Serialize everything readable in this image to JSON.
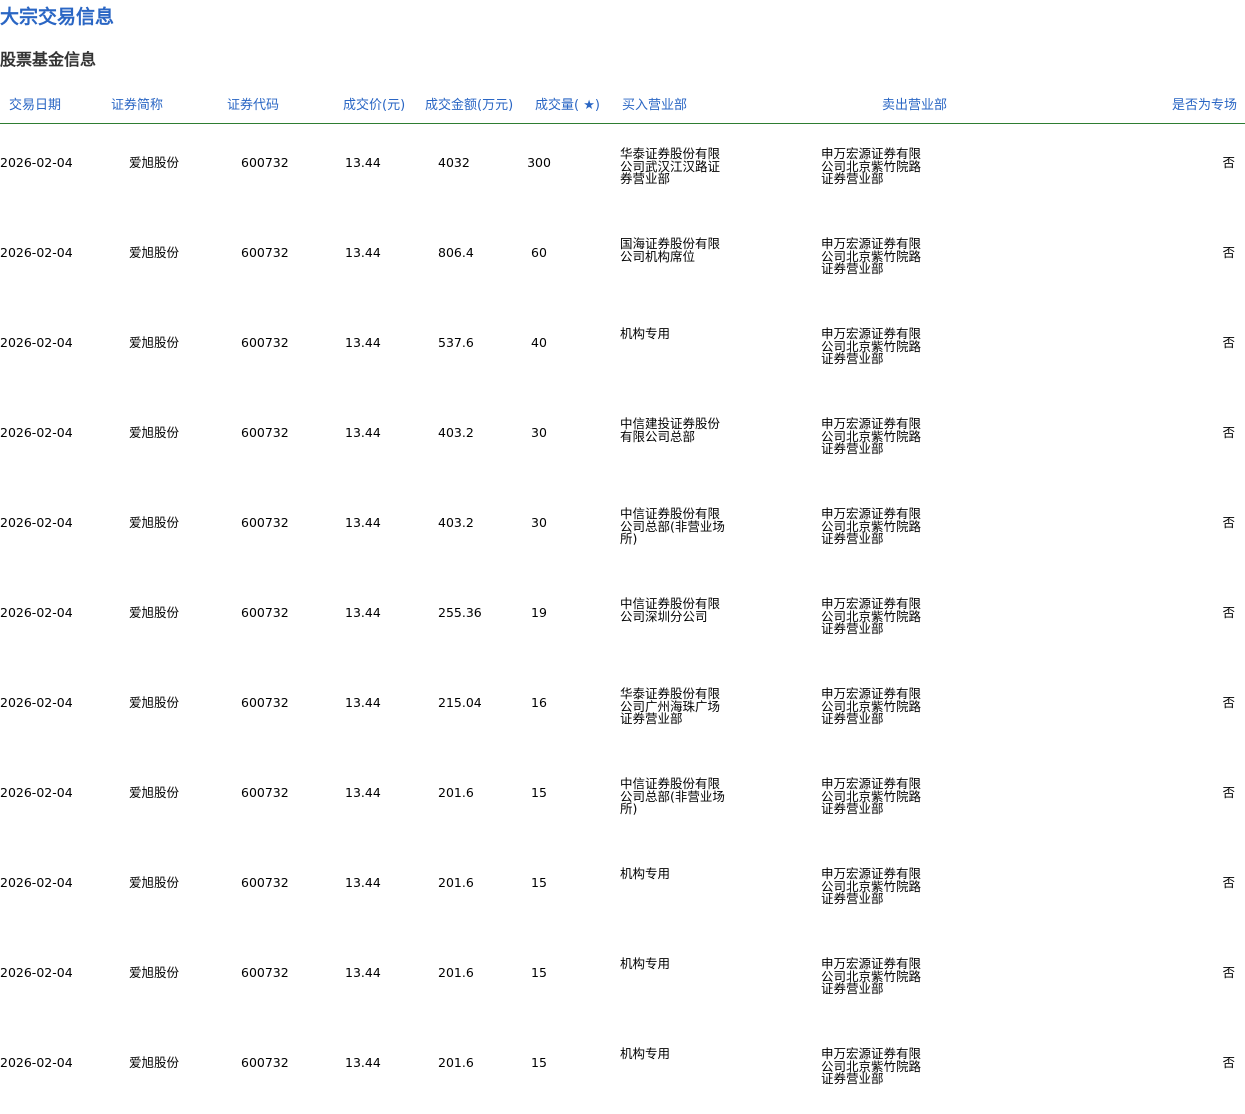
{
  "page_title": "大宗交易信息",
  "section_title": "股票基金信息",
  "columns": {
    "date": "交易日期",
    "name": "证券简称",
    "code": "证券代码",
    "price": "成交价(元)",
    "amount": "成交金额(万元)",
    "volume": "成交量( ★)",
    "buyer": "买入营业部",
    "seller": "卖出营业部",
    "special": "是否为专场"
  },
  "rows": [
    {
      "date": "2026-02-04",
      "name": "爱旭股份",
      "code": "600732",
      "price": "13.44",
      "amount": "4032",
      "volume": "300",
      "buyer": "华泰证券股份有限公司武汉江汉路证券营业部",
      "seller": "申万宏源证券有限公司北京紫竹院路证券营业部",
      "special": "否"
    },
    {
      "date": "2026-02-04",
      "name": "爱旭股份",
      "code": "600732",
      "price": "13.44",
      "amount": "806.4",
      "volume": "60",
      "buyer": "国海证券股份有限公司机构席位",
      "seller": "申万宏源证券有限公司北京紫竹院路证券营业部",
      "special": "否"
    },
    {
      "date": "2026-02-04",
      "name": "爱旭股份",
      "code": "600732",
      "price": "13.44",
      "amount": "537.6",
      "volume": "40",
      "buyer": "机构专用",
      "seller": "申万宏源证券有限公司北京紫竹院路证券营业部",
      "special": "否"
    },
    {
      "date": "2026-02-04",
      "name": "爱旭股份",
      "code": "600732",
      "price": "13.44",
      "amount": "403.2",
      "volume": "30",
      "buyer": "中信建投证券股份有限公司总部",
      "seller": "申万宏源证券有限公司北京紫竹院路证券营业部",
      "special": "否"
    },
    {
      "date": "2026-02-04",
      "name": "爱旭股份",
      "code": "600732",
      "price": "13.44",
      "amount": "403.2",
      "volume": "30",
      "buyer": "中信证券股份有限公司总部(非营业场所)",
      "seller": "申万宏源证券有限公司北京紫竹院路证券营业部",
      "special": "否"
    },
    {
      "date": "2026-02-04",
      "name": "爱旭股份",
      "code": "600732",
      "price": "13.44",
      "amount": "255.36",
      "volume": "19",
      "buyer": "中信证券股份有限公司深圳分公司",
      "seller": "申万宏源证券有限公司北京紫竹院路证券营业部",
      "special": "否"
    },
    {
      "date": "2026-02-04",
      "name": "爱旭股份",
      "code": "600732",
      "price": "13.44",
      "amount": "215.04",
      "volume": "16",
      "buyer": "华泰证券股份有限公司广州海珠广场证券营业部",
      "seller": "申万宏源证券有限公司北京紫竹院路证券营业部",
      "special": "否"
    },
    {
      "date": "2026-02-04",
      "name": "爱旭股份",
      "code": "600732",
      "price": "13.44",
      "amount": "201.6",
      "volume": "15",
      "buyer": "中信证券股份有限公司总部(非营业场所)",
      "seller": "申万宏源证券有限公司北京紫竹院路证券营业部",
      "special": "否"
    },
    {
      "date": "2026-02-04",
      "name": "爱旭股份",
      "code": "600732",
      "price": "13.44",
      "amount": "201.6",
      "volume": "15",
      "buyer": "机构专用",
      "seller": "申万宏源证券有限公司北京紫竹院路证券营业部",
      "special": "否"
    },
    {
      "date": "2026-02-04",
      "name": "爱旭股份",
      "code": "600732",
      "price": "13.44",
      "amount": "201.6",
      "volume": "15",
      "buyer": "机构专用",
      "seller": "申万宏源证券有限公司北京紫竹院路证券营业部",
      "special": "否"
    },
    {
      "date": "2026-02-04",
      "name": "爱旭股份",
      "code": "600732",
      "price": "13.44",
      "amount": "201.6",
      "volume": "15",
      "buyer": "机构专用",
      "seller": "申万宏源证券有限公司北京紫竹院路证券营业部",
      "special": "否"
    }
  ]
}
